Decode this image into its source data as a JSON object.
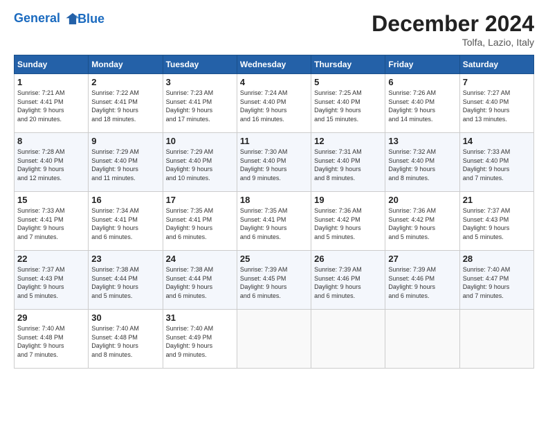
{
  "logo": {
    "line1": "General",
    "line2": "Blue"
  },
  "title": "December 2024",
  "location": "Tolfa, Lazio, Italy",
  "days_of_week": [
    "Sunday",
    "Monday",
    "Tuesday",
    "Wednesday",
    "Thursday",
    "Friday",
    "Saturday"
  ],
  "weeks": [
    [
      {
        "day": "1",
        "info": "Sunrise: 7:21 AM\nSunset: 4:41 PM\nDaylight: 9 hours\nand 20 minutes."
      },
      {
        "day": "2",
        "info": "Sunrise: 7:22 AM\nSunset: 4:41 PM\nDaylight: 9 hours\nand 18 minutes."
      },
      {
        "day": "3",
        "info": "Sunrise: 7:23 AM\nSunset: 4:41 PM\nDaylight: 9 hours\nand 17 minutes."
      },
      {
        "day": "4",
        "info": "Sunrise: 7:24 AM\nSunset: 4:40 PM\nDaylight: 9 hours\nand 16 minutes."
      },
      {
        "day": "5",
        "info": "Sunrise: 7:25 AM\nSunset: 4:40 PM\nDaylight: 9 hours\nand 15 minutes."
      },
      {
        "day": "6",
        "info": "Sunrise: 7:26 AM\nSunset: 4:40 PM\nDaylight: 9 hours\nand 14 minutes."
      },
      {
        "day": "7",
        "info": "Sunrise: 7:27 AM\nSunset: 4:40 PM\nDaylight: 9 hours\nand 13 minutes."
      }
    ],
    [
      {
        "day": "8",
        "info": "Sunrise: 7:28 AM\nSunset: 4:40 PM\nDaylight: 9 hours\nand 12 minutes."
      },
      {
        "day": "9",
        "info": "Sunrise: 7:29 AM\nSunset: 4:40 PM\nDaylight: 9 hours\nand 11 minutes."
      },
      {
        "day": "10",
        "info": "Sunrise: 7:29 AM\nSunset: 4:40 PM\nDaylight: 9 hours\nand 10 minutes."
      },
      {
        "day": "11",
        "info": "Sunrise: 7:30 AM\nSunset: 4:40 PM\nDaylight: 9 hours\nand 9 minutes."
      },
      {
        "day": "12",
        "info": "Sunrise: 7:31 AM\nSunset: 4:40 PM\nDaylight: 9 hours\nand 8 minutes."
      },
      {
        "day": "13",
        "info": "Sunrise: 7:32 AM\nSunset: 4:40 PM\nDaylight: 9 hours\nand 8 minutes."
      },
      {
        "day": "14",
        "info": "Sunrise: 7:33 AM\nSunset: 4:40 PM\nDaylight: 9 hours\nand 7 minutes."
      }
    ],
    [
      {
        "day": "15",
        "info": "Sunrise: 7:33 AM\nSunset: 4:41 PM\nDaylight: 9 hours\nand 7 minutes."
      },
      {
        "day": "16",
        "info": "Sunrise: 7:34 AM\nSunset: 4:41 PM\nDaylight: 9 hours\nand 6 minutes."
      },
      {
        "day": "17",
        "info": "Sunrise: 7:35 AM\nSunset: 4:41 PM\nDaylight: 9 hours\nand 6 minutes."
      },
      {
        "day": "18",
        "info": "Sunrise: 7:35 AM\nSunset: 4:41 PM\nDaylight: 9 hours\nand 6 minutes."
      },
      {
        "day": "19",
        "info": "Sunrise: 7:36 AM\nSunset: 4:42 PM\nDaylight: 9 hours\nand 5 minutes."
      },
      {
        "day": "20",
        "info": "Sunrise: 7:36 AM\nSunset: 4:42 PM\nDaylight: 9 hours\nand 5 minutes."
      },
      {
        "day": "21",
        "info": "Sunrise: 7:37 AM\nSunset: 4:43 PM\nDaylight: 9 hours\nand 5 minutes."
      }
    ],
    [
      {
        "day": "22",
        "info": "Sunrise: 7:37 AM\nSunset: 4:43 PM\nDaylight: 9 hours\nand 5 minutes."
      },
      {
        "day": "23",
        "info": "Sunrise: 7:38 AM\nSunset: 4:44 PM\nDaylight: 9 hours\nand 5 minutes."
      },
      {
        "day": "24",
        "info": "Sunrise: 7:38 AM\nSunset: 4:44 PM\nDaylight: 9 hours\nand 6 minutes."
      },
      {
        "day": "25",
        "info": "Sunrise: 7:39 AM\nSunset: 4:45 PM\nDaylight: 9 hours\nand 6 minutes."
      },
      {
        "day": "26",
        "info": "Sunrise: 7:39 AM\nSunset: 4:46 PM\nDaylight: 9 hours\nand 6 minutes."
      },
      {
        "day": "27",
        "info": "Sunrise: 7:39 AM\nSunset: 4:46 PM\nDaylight: 9 hours\nand 6 minutes."
      },
      {
        "day": "28",
        "info": "Sunrise: 7:40 AM\nSunset: 4:47 PM\nDaylight: 9 hours\nand 7 minutes."
      }
    ],
    [
      {
        "day": "29",
        "info": "Sunrise: 7:40 AM\nSunset: 4:48 PM\nDaylight: 9 hours\nand 7 minutes."
      },
      {
        "day": "30",
        "info": "Sunrise: 7:40 AM\nSunset: 4:48 PM\nDaylight: 9 hours\nand 8 minutes."
      },
      {
        "day": "31",
        "info": "Sunrise: 7:40 AM\nSunset: 4:49 PM\nDaylight: 9 hours\nand 9 minutes."
      },
      null,
      null,
      null,
      null
    ]
  ]
}
